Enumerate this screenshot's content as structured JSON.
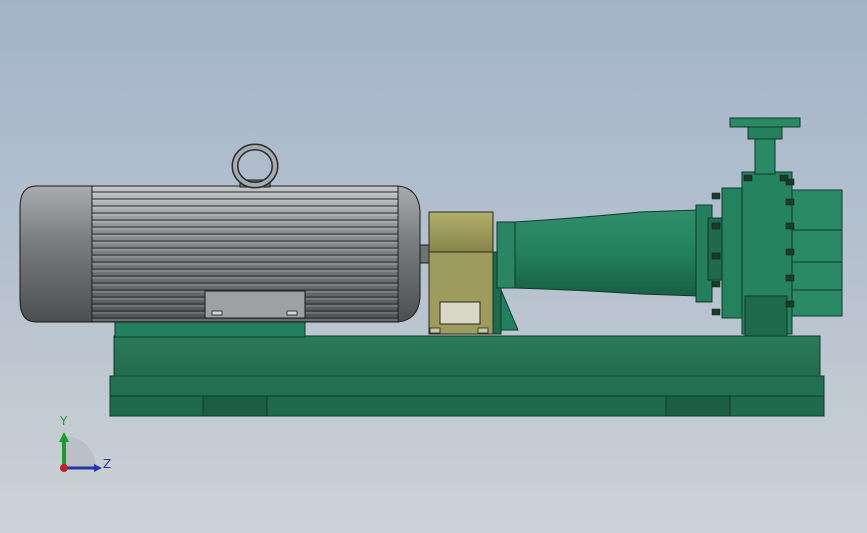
{
  "viewport": {
    "background_top": "#a3b4c9",
    "background_bottom": "#cdd2d6"
  },
  "model": {
    "part_color_green": "#227a5a",
    "part_color_olive": "#9c9a5c",
    "motor_color": "#8b8e91"
  },
  "triad": {
    "y_label": "Y",
    "z_label": "Z",
    "y_color": "#1e9b2a",
    "z_color": "#2335a8",
    "origin_color": "#c0202a"
  }
}
